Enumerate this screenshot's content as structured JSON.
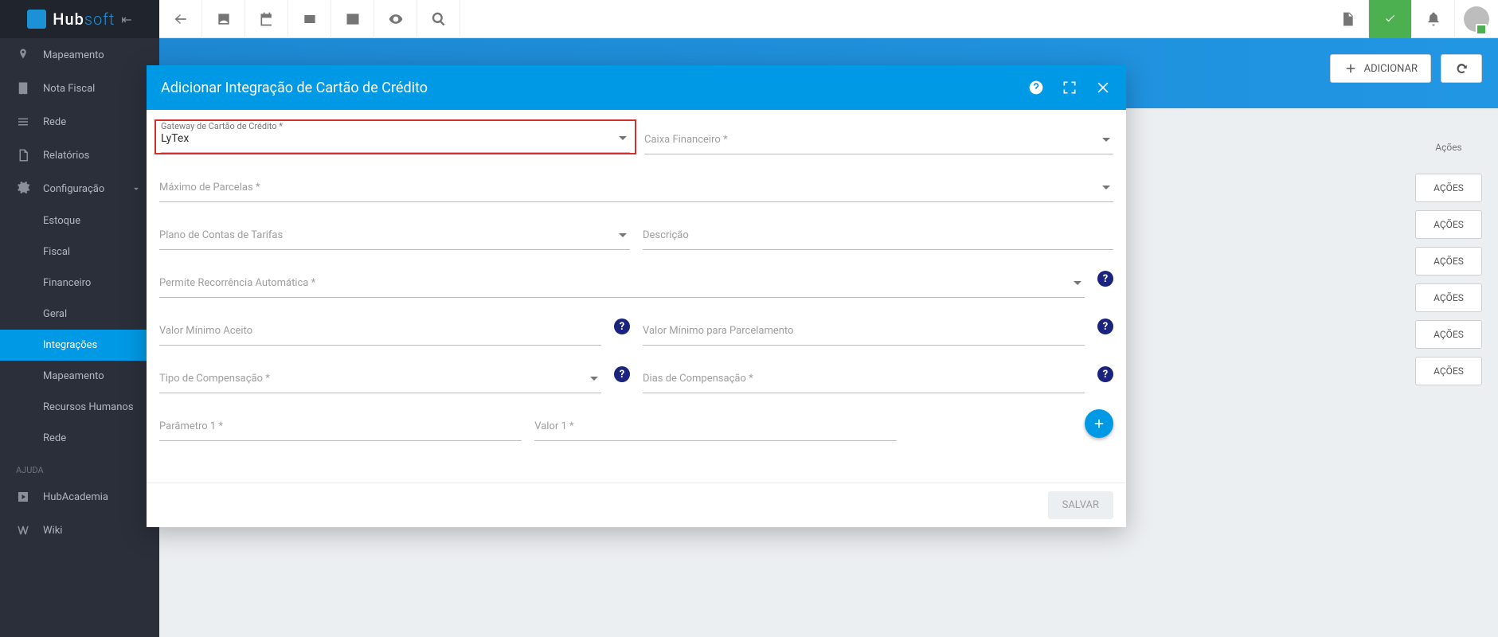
{
  "brand": {
    "hub": "Hub",
    "soft": "soft"
  },
  "sidebar": {
    "items": [
      {
        "label": "Mapeamento"
      },
      {
        "label": "Nota Fiscal"
      },
      {
        "label": "Rede"
      },
      {
        "label": "Relatórios"
      },
      {
        "label": "Configuração"
      }
    ],
    "sub": [
      {
        "label": "Estoque"
      },
      {
        "label": "Fiscal"
      },
      {
        "label": "Financeiro"
      },
      {
        "label": "Geral"
      },
      {
        "label": "Integrações"
      },
      {
        "label": "Mapeamento"
      },
      {
        "label": "Recursos Humanos"
      },
      {
        "label": "Rede"
      }
    ],
    "help_section": "AJUDA",
    "help_items": [
      {
        "label": "HubAcademia"
      },
      {
        "label": "Wiki"
      }
    ]
  },
  "page": {
    "btn_add": "ADICIONAR",
    "th_acoes": "Ações",
    "row_action": "AÇÕES"
  },
  "modal": {
    "title": "Adicionar Integração de Cartão de Crédito",
    "gateway_label": "Gateway de Cartão de Crédito *",
    "gateway_value": "LyTex",
    "caixa_label": "Caixa Financeiro *",
    "max_parcelas_label": "Máximo de Parcelas *",
    "plano_tarifas_label": "Plano de Contas de Tarifas",
    "descricao_label": "Descrição",
    "recorrencia_label": "Permite Recorrência Automática *",
    "valor_min_label": "Valor Mínimo Aceito",
    "valor_min_parc_label": "Valor Mínimo para Parcelamento",
    "tipo_comp_label": "Tipo de Compensação *",
    "dias_comp_label": "Dias de Compensação *",
    "param1_label": "Parâmetro 1 *",
    "valor1_label": "Valor 1 *",
    "save": "SALVAR",
    "help_glyph": "?"
  }
}
